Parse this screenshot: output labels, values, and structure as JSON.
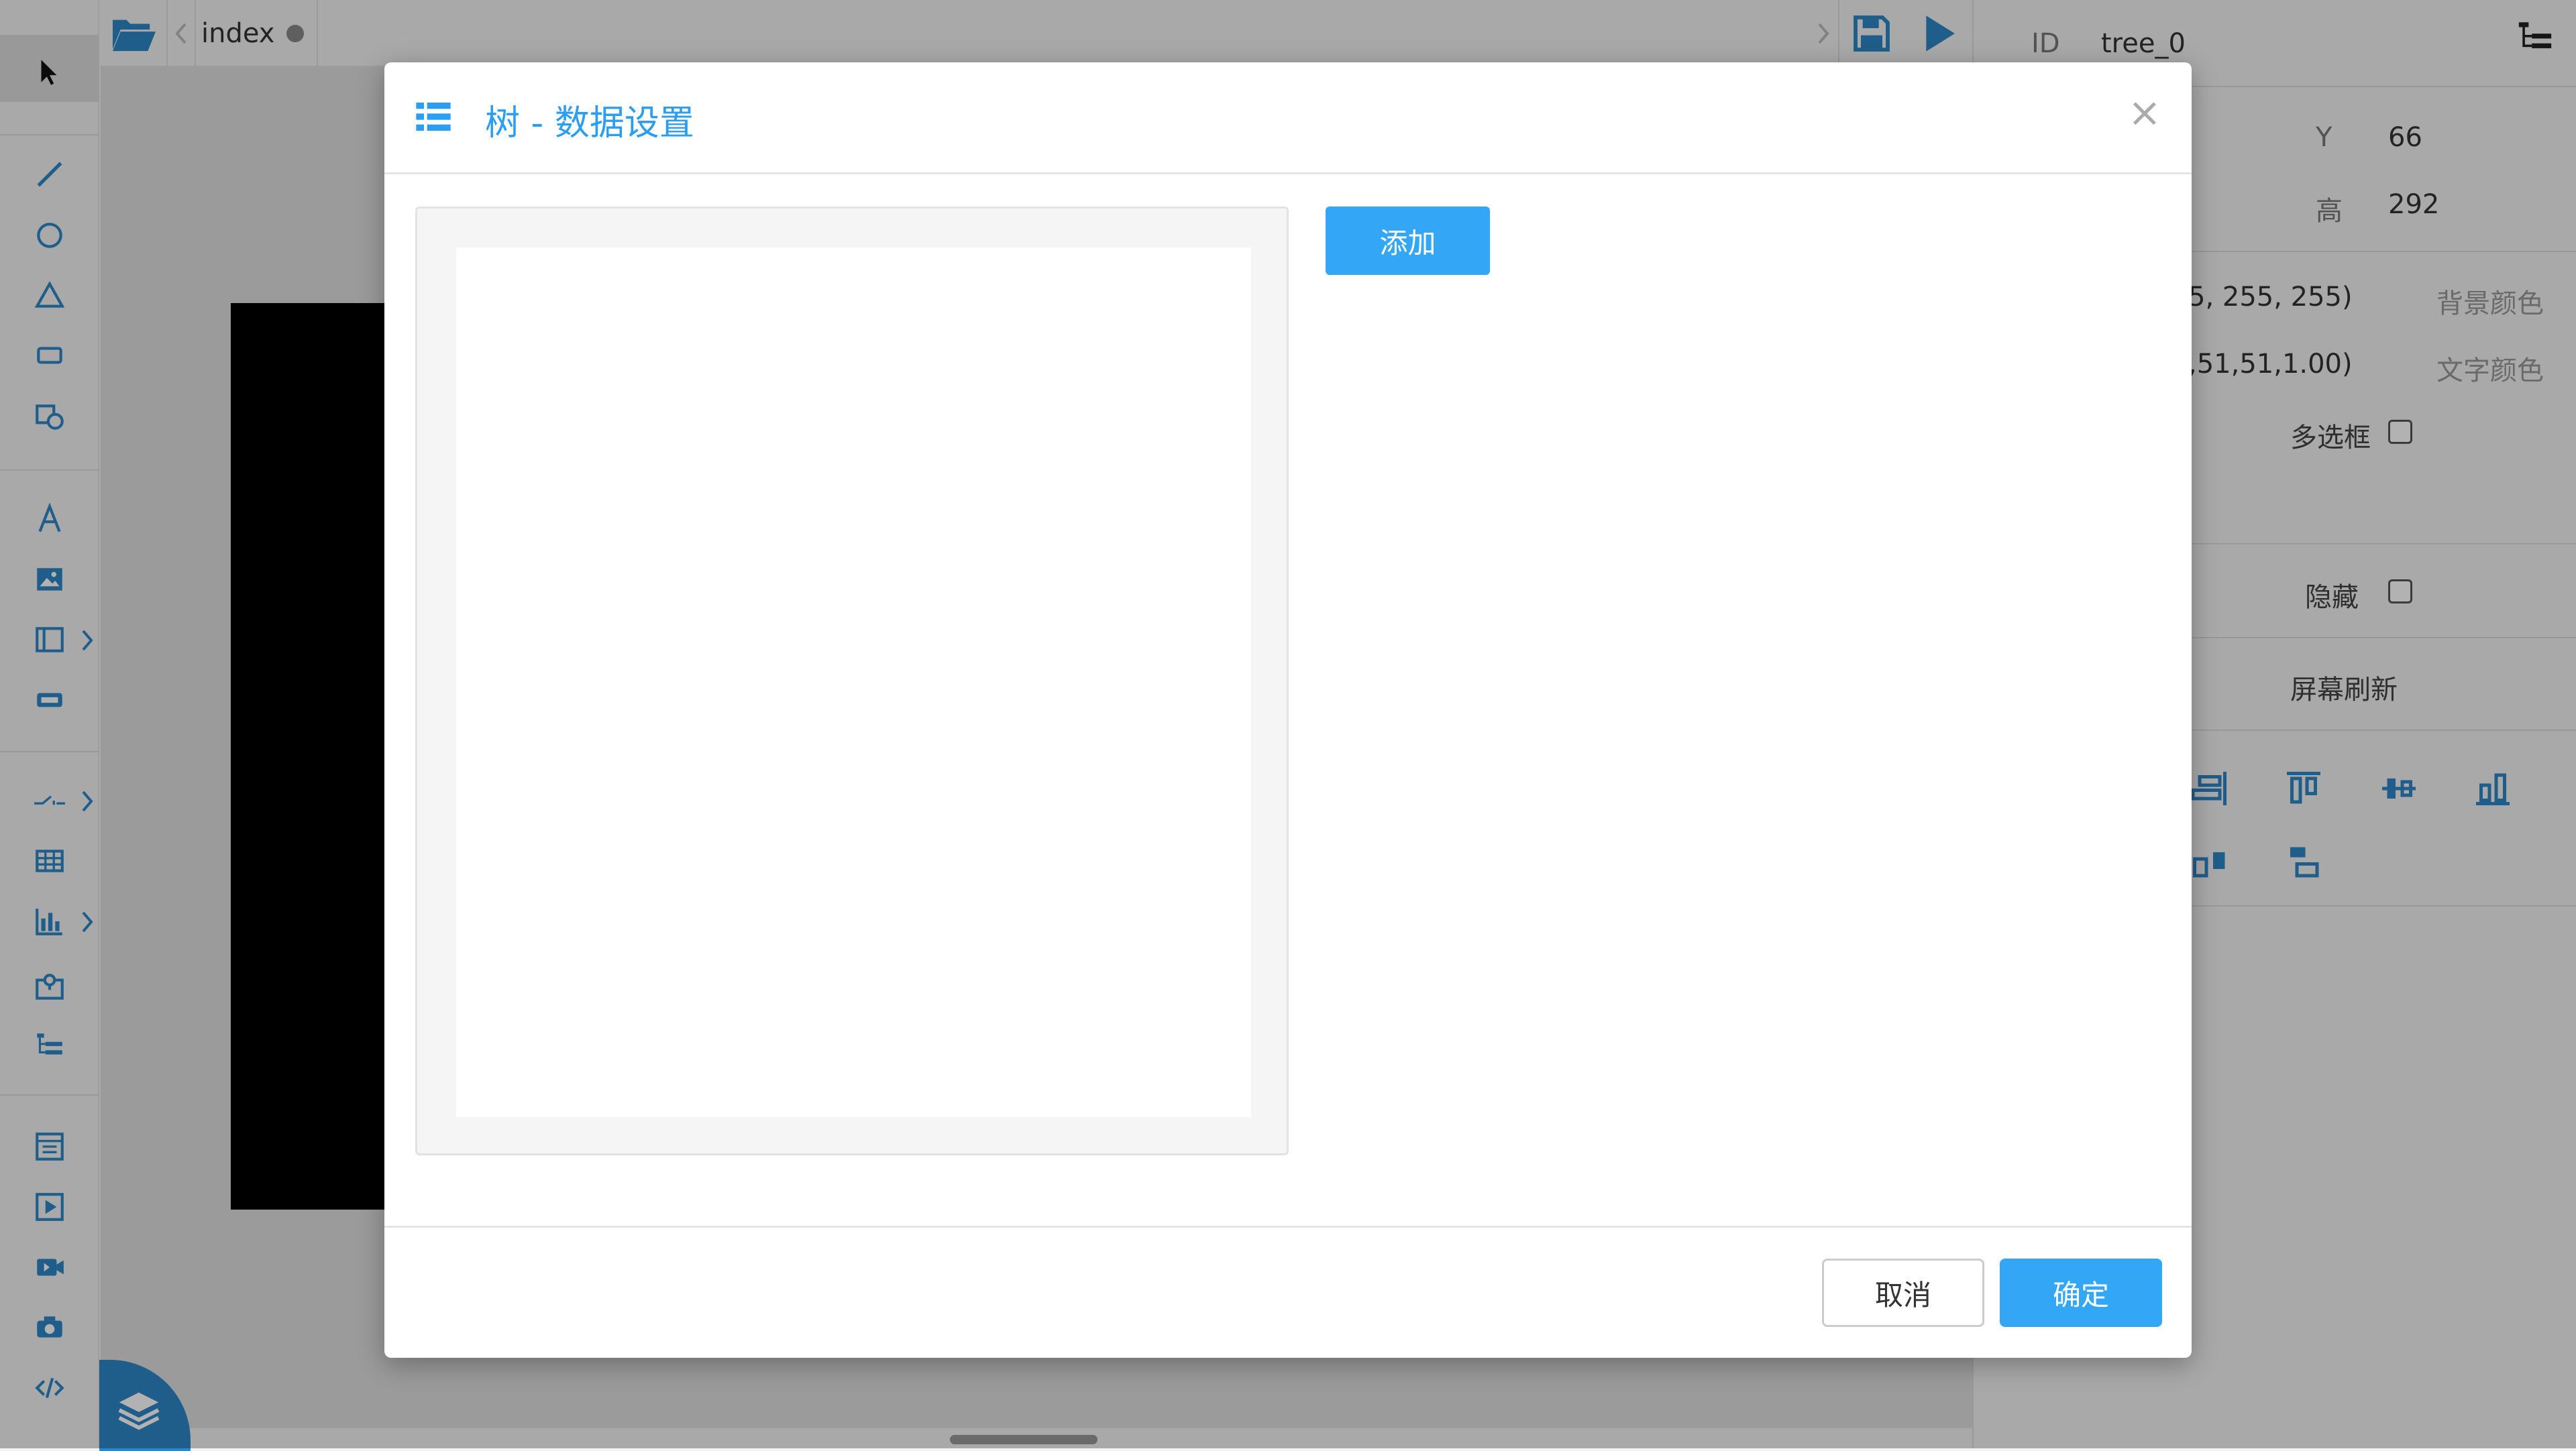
{
  "editor": {
    "tab_label": "index",
    "properties": {
      "id_label": "ID",
      "id_value": "tree_0",
      "y_label": "Y",
      "y_value": "66",
      "height_label": "高",
      "height_value": "292",
      "bg_color_value": "5, 255, 255)",
      "bg_color_label": "背景颜色",
      "text_color_value": ",51,51,1.00)",
      "text_color_label": "文字颜色",
      "multiselect_label": "多选框",
      "hidden_label": "隐藏",
      "screen_refresh_label": "屏幕刷新"
    }
  },
  "dialog": {
    "title": "树 - 数据设置",
    "close_symbol": "×",
    "add_label": "添加",
    "cancel_label": "取消",
    "confirm_label": "确定"
  },
  "colors": {
    "accent": "#33a6f5",
    "title": "#2b9ef3",
    "icon": "#2d86c6"
  }
}
